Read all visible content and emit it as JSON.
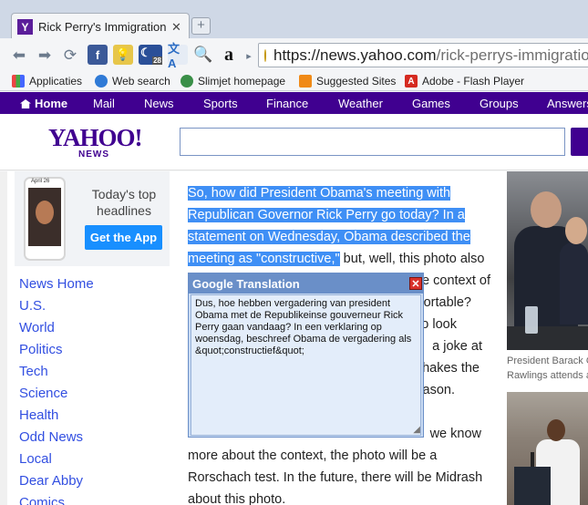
{
  "browser": {
    "tab_title": "Rick Perry's Immigration N",
    "tab_favicon": "Y",
    "url_host": "https://news.yahoo.com",
    "url_path": "/rick-perrys-immigration",
    "ext_badge": "28",
    "bookmarks": [
      {
        "label": "Applicaties",
        "icon": "apps-grid-icon"
      },
      {
        "label": "Web search",
        "icon": "search-globe-icon"
      },
      {
        "label": "Slimjet homepage",
        "icon": "slimjet-icon"
      },
      {
        "label": "Suggested Sites",
        "icon": "suggested-sites-icon"
      },
      {
        "label": "Adobe - Flash Player",
        "icon": "adobe-icon"
      }
    ]
  },
  "yahoo": {
    "nav": [
      "Home",
      "Mail",
      "News",
      "Sports",
      "Finance",
      "Weather",
      "Games",
      "Groups",
      "Answers"
    ],
    "logo": "YAHOO!",
    "logo_sub": "NEWS",
    "brand_color": "#400090"
  },
  "promo": {
    "text": "Today's top headlines",
    "button": "Get the App",
    "phone_date": "April 26"
  },
  "left_nav": [
    "News Home",
    "U.S.",
    "World",
    "Politics",
    "Tech",
    "Science",
    "Health",
    "Odd News",
    "Local",
    "Dear Abby",
    "Comics"
  ],
  "article": {
    "lines": [
      {
        "sel": "So, how did President Obama's meeting with",
        "rest": ""
      },
      {
        "sel": "Republican Governor Rick Perry go today? In a",
        "rest": ""
      },
      {
        "sel": "statement on Wednesday, Obama described the",
        "rest": ""
      },
      {
        "sel": "meeting as \"constructive,\"",
        "rest": " but, well, this photo also"
      },
      {
        "sel": "",
        "rest": "e context of"
      },
      {
        "sel": "",
        "rest": "ortable?"
      },
      {
        "sel": "",
        "rest": "o look"
      },
      {
        "sel": "",
        "rest": "a joke at"
      },
      {
        "sel": "",
        "rest": "hakes the"
      },
      {
        "sel": "",
        "rest": "ason."
      },
      {
        "sel": "",
        "rest": ""
      },
      {
        "sel": "",
        "rest": "we know"
      },
      {
        "sel": "",
        "rest": "more about the context, the photo will be a"
      },
      {
        "sel": "",
        "rest": "Rorschach test. In the future, there will be Midrash"
      },
      {
        "sel": "",
        "rest": "about this photo."
      }
    ]
  },
  "translation": {
    "title": "Google Translation",
    "close": "✕",
    "text": "Dus, hoe hebben vergadering van president Obama met de Republikeinse gouverneur Rick Perry gaan vandaag? In een verklaring op woensdag, beschreef Obama de vergadering als &quot;constructief&quot;"
  },
  "right_column": {
    "caption_line1": "President Barack O",
    "caption_line2": "Rawlings attends a"
  }
}
